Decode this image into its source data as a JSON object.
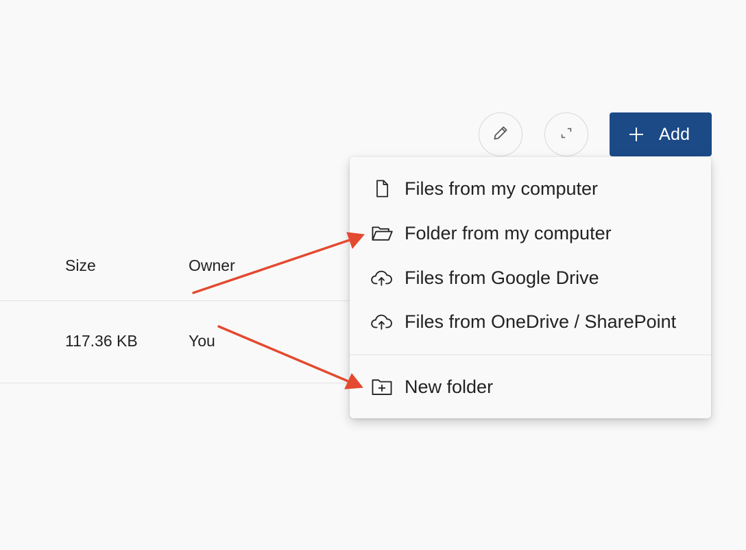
{
  "toolbar": {
    "edit_icon": "pencil-icon",
    "expand_icon": "expand-icon",
    "add_label": "Add"
  },
  "table": {
    "headers": {
      "size": "Size",
      "owner": "Owner"
    },
    "rows": [
      {
        "size": "117.36 KB",
        "owner": "You"
      }
    ]
  },
  "add_menu": {
    "items": [
      {
        "label": "Files from my computer",
        "icon": "file-icon"
      },
      {
        "label": "Folder from my computer",
        "icon": "folder-open-icon"
      },
      {
        "label": "Files from Google Drive",
        "icon": "cloud-upload-icon"
      },
      {
        "label": "Files from OneDrive / SharePoint",
        "icon": "cloud-upload-icon"
      },
      {
        "label": "New folder",
        "icon": "folder-plus-icon"
      }
    ]
  },
  "colors": {
    "accent": "#1b4a87",
    "annotation_arrow": "#e34a2f",
    "background": "#f9f9f9"
  }
}
